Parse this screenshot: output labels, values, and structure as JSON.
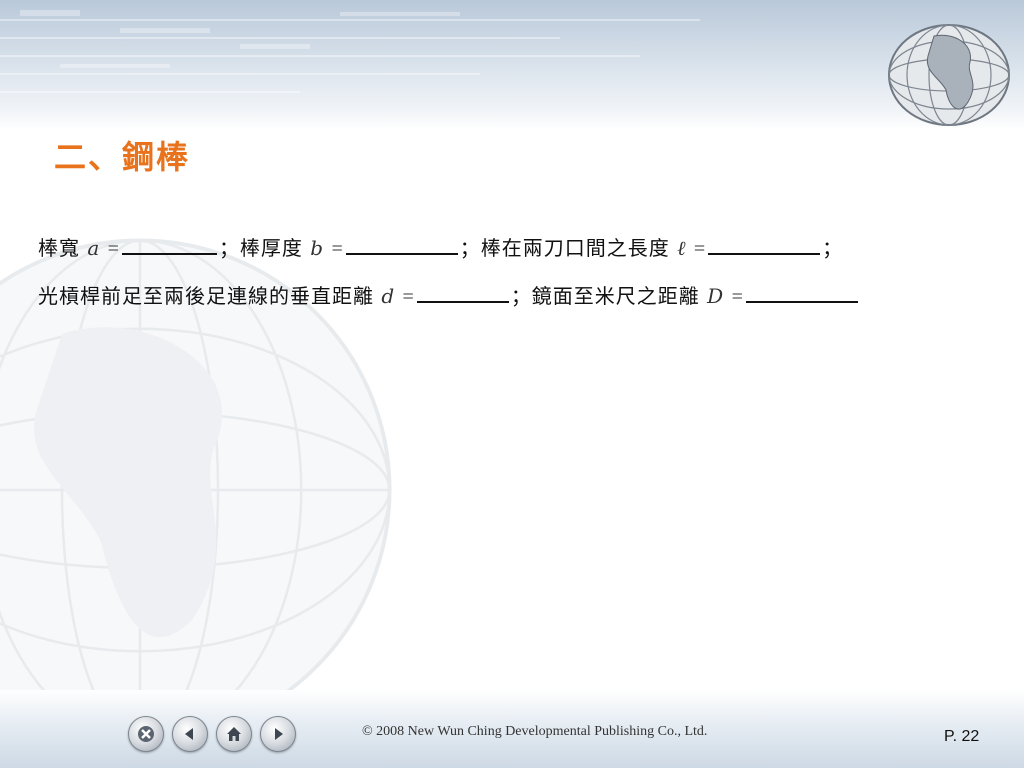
{
  "title": "二、鋼棒",
  "line1": {
    "seg1": "棒寬",
    "var_a": "a",
    "eq": "=",
    "sep1": "；棒厚度",
    "var_b": "b",
    "sep2": "；棒在兩刀口間之長度",
    "var_l": "ℓ",
    "end": "；"
  },
  "line2": {
    "seg1": "光槓桿前足至兩後足連線的垂直距離",
    "var_d": "d",
    "eq": "=",
    "sep1": "；鏡面至米尺之距離",
    "var_D": "D"
  },
  "footer": {
    "copyright": "© 2008 New Wun Ching Developmental Publishing Co., Ltd.",
    "page": "P. 22"
  },
  "nav": {
    "icons": [
      "close-icon",
      "previous-icon",
      "home-icon",
      "next-icon"
    ]
  },
  "colors": {
    "title": "#e8731c",
    "header": "#b9c8d9"
  }
}
